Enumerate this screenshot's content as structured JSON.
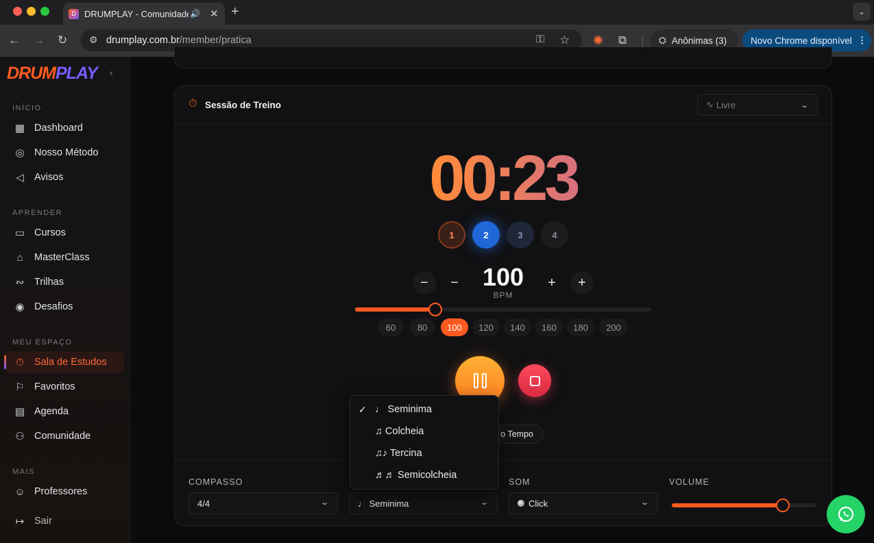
{
  "browser": {
    "tab_title": "DRUMPLAY - Comunidade",
    "tab_favicon": "D",
    "url_domain": "drumplay.com.br",
    "url_path": "/member/pratica",
    "incognito_label": "Anônimas (3)",
    "update_label": "Novo Chrome disponível",
    "icons": [
      "back-icon",
      "forward-icon",
      "reload-icon",
      "site-settings-icon",
      "key-icon",
      "star-icon",
      "extension-icon",
      "puzzle-icon",
      "incognito-icon",
      "menu-icon",
      "speaker-icon",
      "close-icon",
      "new-tab-icon"
    ]
  },
  "sidebar": {
    "logo_a": "DRUM",
    "logo_b": "PLAY",
    "sections": {
      "inicio": "INÍCIO",
      "aprender": "APRENDER",
      "meu_espaco": "MEU ESPAÇO",
      "mais": "MAIS"
    },
    "items": {
      "dashboard": "Dashboard",
      "metodo": "Nosso Método",
      "avisos": "Avisos",
      "cursos": "Cursos",
      "masterclass": "MasterClass",
      "trilhas": "Trilhas",
      "desafios": "Desafios",
      "sala": "Sala de Estudos",
      "favoritos": "Favoritos",
      "agenda": "Agenda",
      "comunidade": "Comunidade",
      "professores": "Professores",
      "sair": "Sair"
    }
  },
  "session": {
    "title": "Sessão de Treino",
    "mode": "Livre",
    "timer": "00:23",
    "beats": [
      "1",
      "2",
      "3",
      "4"
    ],
    "active_beat": 2,
    "bpm": "100",
    "bpm_unit": "BPM",
    "bpm_slider_fraction": 0.27,
    "presets": [
      "60",
      "80",
      "100",
      "120",
      "140",
      "160",
      "180",
      "200"
    ],
    "selected_preset": "100",
    "tempo_button_fragment": "o Tempo"
  },
  "settings": {
    "compasso_label": "COMPASSO",
    "compasso_value": "4/4",
    "figura_value": "♩ Seminima",
    "som_label": "SOM",
    "som_value": "Click",
    "volume_label": "VOLUME",
    "volume_fraction": 0.77
  },
  "dropdown": {
    "options": [
      "♩ Seminima",
      "♫ Colcheia",
      "♫♪ Tercina",
      "♬♬ Semicolcheia"
    ],
    "selected_index": 0
  },
  "colors": {
    "accent": "#ff5a1f",
    "purple": "#7a5cff",
    "beat_active": "#2167d8",
    "stop": "#e8374c",
    "whatsapp": "#25d366"
  }
}
